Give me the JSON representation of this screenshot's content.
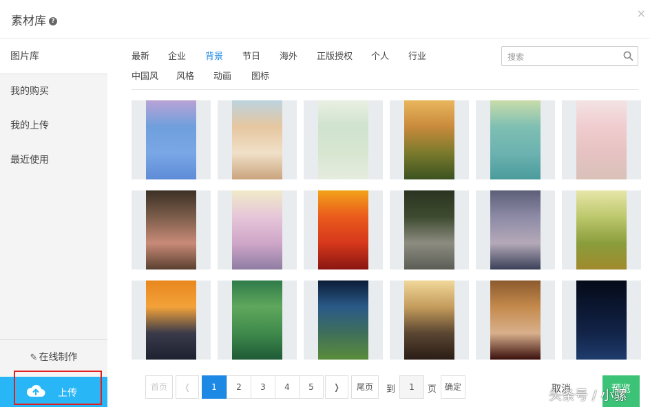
{
  "header": {
    "title": "素材库",
    "help_icon": "question-circle-icon",
    "close_icon": "close-icon",
    "close_label": "×"
  },
  "sidebar": {
    "items": [
      {
        "label": "图片库",
        "active": true
      },
      {
        "label": "我的购买",
        "active": false
      },
      {
        "label": "我的上传",
        "active": false
      },
      {
        "label": "最近使用",
        "active": false
      }
    ],
    "online_make": "在线制作",
    "upload": "上传"
  },
  "categories": {
    "row1": [
      "最新",
      "企业",
      "背景",
      "节日",
      "海外",
      "正版授权",
      "个人",
      "行业"
    ],
    "row2": [
      "中国风",
      "风格",
      "动画",
      "图标"
    ],
    "active": "背景"
  },
  "search": {
    "placeholder": "搜索",
    "value": ""
  },
  "thumbnails": [
    {
      "name": "fog-lake",
      "colors": [
        "#b9a3d6",
        "#6f9fdc",
        "#7aa7e6",
        "#5d8bd6"
      ]
    },
    {
      "name": "girl-beach",
      "colors": [
        "#bcd3df",
        "#e6c7a0",
        "#f0e0c8",
        "#caa47d"
      ]
    },
    {
      "name": "cherry-branch",
      "colors": [
        "#e9efe2",
        "#cfe3cf",
        "#d8e6d0",
        "#e5ece0"
      ]
    },
    {
      "name": "red-flower-field",
      "colors": [
        "#e8b65c",
        "#c98a3c",
        "#7a7a2c",
        "#3b5220"
      ]
    },
    {
      "name": "pink-flower-teal",
      "colors": [
        "#c9dca9",
        "#7fbfb3",
        "#6cb2b0",
        "#4b9b9c"
      ]
    },
    {
      "name": "peach-blossom",
      "colors": [
        "#f3e3e3",
        "#f0cccf",
        "#e6c2c2",
        "#d9c1b8"
      ]
    },
    {
      "name": "macarons-box",
      "colors": [
        "#3c3025",
        "#7b5d4a",
        "#c98a78",
        "#5a4030"
      ]
    },
    {
      "name": "magnolia",
      "colors": [
        "#f0eac8",
        "#e6c6d9",
        "#cfa6c8",
        "#8f7da3"
      ]
    },
    {
      "name": "red-orange-curtain",
      "colors": [
        "#f2a21a",
        "#ea5a1c",
        "#d6381c",
        "#8a1612"
      ]
    },
    {
      "name": "book-bench",
      "colors": [
        "#2a3320",
        "#3e4a30",
        "#8c8c80",
        "#5b5d55"
      ]
    },
    {
      "name": "sky-clouds",
      "colors": [
        "#5c5f77",
        "#8d8aa6",
        "#b4a9b8",
        "#3a4058"
      ]
    },
    {
      "name": "moss-bokeh",
      "colors": [
        "#e6e6a8",
        "#bdc86c",
        "#8a9d3c",
        "#a08a2c"
      ]
    },
    {
      "name": "sunset-sea",
      "colors": [
        "#e8871e",
        "#f3a23a",
        "#3a3a4a",
        "#1c2130"
      ]
    },
    {
      "name": "heart-stem",
      "colors": [
        "#2f7b4a",
        "#5fa75c",
        "#3f8a4c",
        "#1f5a36"
      ]
    },
    {
      "name": "fireworks",
      "colors": [
        "#0c1c38",
        "#2a5a88",
        "#3f6f5a",
        "#5a8c3a"
      ]
    },
    {
      "name": "girl-street",
      "colors": [
        "#f0d89a",
        "#c59c5c",
        "#5a4632",
        "#2a1d16"
      ]
    },
    {
      "name": "heart-jar",
      "colors": [
        "#8c5a2e",
        "#c48a4c",
        "#d8b08c",
        "#3a0f0c"
      ]
    },
    {
      "name": "earth-night",
      "colors": [
        "#050b18",
        "#0b1630",
        "#122448",
        "#1e3c6c"
      ]
    }
  ],
  "pagination": {
    "first": "首页",
    "prev": "❬",
    "pages": [
      "1",
      "2",
      "3",
      "4",
      "5"
    ],
    "current": "1",
    "next": "❭",
    "last": "尾页",
    "goto": "到",
    "goto_value": "1",
    "page_unit": "页",
    "confirm": "确定"
  },
  "actions": {
    "cancel": "取消",
    "preview": "预览"
  },
  "watermark": "头条号 / 小骡"
}
